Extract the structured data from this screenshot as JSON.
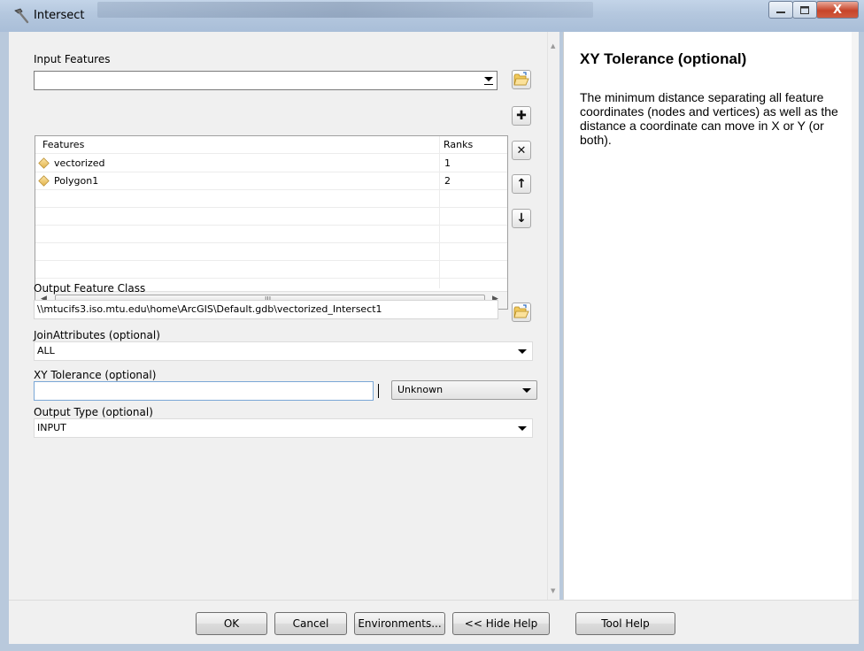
{
  "window": {
    "title": "Intersect",
    "icon": "hammer-icon",
    "controls": [
      "minimize-icon",
      "maximize-icon",
      "close-icon"
    ],
    "close_glyph": "X"
  },
  "form": {
    "input_features": {
      "label": "Input Features",
      "value": "",
      "icon": "folder-open-icon"
    },
    "features_table": {
      "headers": [
        "Features",
        "Ranks"
      ],
      "rows": [
        {
          "feature": "vectorized",
          "rank": "1",
          "icon": "polygon-layer-icon"
        },
        {
          "feature": "Polygon1",
          "rank": "2",
          "icon": "polygon-layer-icon"
        }
      ],
      "empty_rows": 6,
      "buttons": [
        {
          "name": "add-row-button",
          "glyph": "✚",
          "icon": "plus-icon"
        },
        {
          "name": "remove-row-button",
          "glyph": "✕",
          "icon": "close-icon"
        },
        {
          "name": "move-up-button",
          "glyph": "↑",
          "icon": "arrow-up-icon"
        },
        {
          "name": "move-down-button",
          "glyph": "↓",
          "icon": "arrow-down-icon"
        }
      ],
      "hscroll_grip": "III"
    },
    "output_feature_class": {
      "label": "Output Feature Class",
      "value": "\\\\mtucifs3.iso.mtu.edu\\home\\ArcGIS\\Default.gdb\\vectorized_Intersect1",
      "icon": "folder-open-icon"
    },
    "join_attributes": {
      "label": "JoinAttributes (optional)",
      "value": "ALL"
    },
    "xy_tolerance": {
      "label": "XY Tolerance (optional)",
      "value": "",
      "unit": "Unknown"
    },
    "output_type": {
      "label": "Output Type (optional)",
      "value": "INPUT"
    }
  },
  "help": {
    "title": "XY Tolerance (optional)",
    "body": "The minimum distance separating all feature coordinates (nodes and vertices) as well as the distance a coordinate can move in X or Y (or both)."
  },
  "buttons": {
    "ok": "OK",
    "cancel": "Cancel",
    "environments": "Environments...",
    "hide_help": "<< Hide Help",
    "tool_help": "Tool Help"
  }
}
